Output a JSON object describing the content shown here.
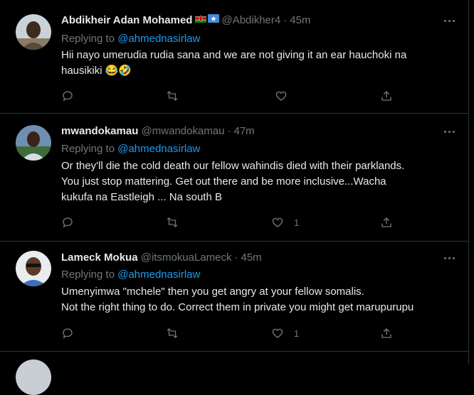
{
  "tweets": [
    {
      "name": "Abdikheir Adan Mohamed",
      "handle": "@Abdikher4",
      "time": "45m",
      "replying_label": "Replying to",
      "replying_to": "@ahmednasirlaw",
      "text_lines": [
        "Hii nayo umerudia rudia sana and we are not giving it an ear hauchoki na",
        "hausikiki 😂🤣"
      ],
      "flags": [
        "kenya-flag-icon",
        "somalia-flag-icon"
      ],
      "like_count": ""
    },
    {
      "name": "mwandokamau",
      "handle": "@mwandokamau",
      "time": "47m",
      "replying_label": "Replying to",
      "replying_to": "@ahmednasirlaw",
      "text_lines": [
        "Or they'll die the cold death our fellow wahindis died with their parklands.",
        "You just stop mattering. Get out there and be more inclusive...Wacha",
        "kukufa na Eastleigh ... Na south B"
      ],
      "like_count": "1"
    },
    {
      "name": "Lameck Mokua",
      "handle": "@itsmokuaLameck",
      "time": "45m",
      "replying_label": "Replying to",
      "replying_to": "@ahmednasirlaw",
      "text_lines": [
        "Umenyimwa \"mchele\" then you get angry at your fellow somalis.",
        "Not the right thing to do. Correct them in private you might get marupurupu"
      ],
      "like_count": "1"
    }
  ],
  "separator": "·",
  "colors": {
    "background": "#000000",
    "link": "#1d9bf0",
    "muted": "#71767b",
    "text": "#e7e9ea",
    "border": "#2f3336"
  }
}
